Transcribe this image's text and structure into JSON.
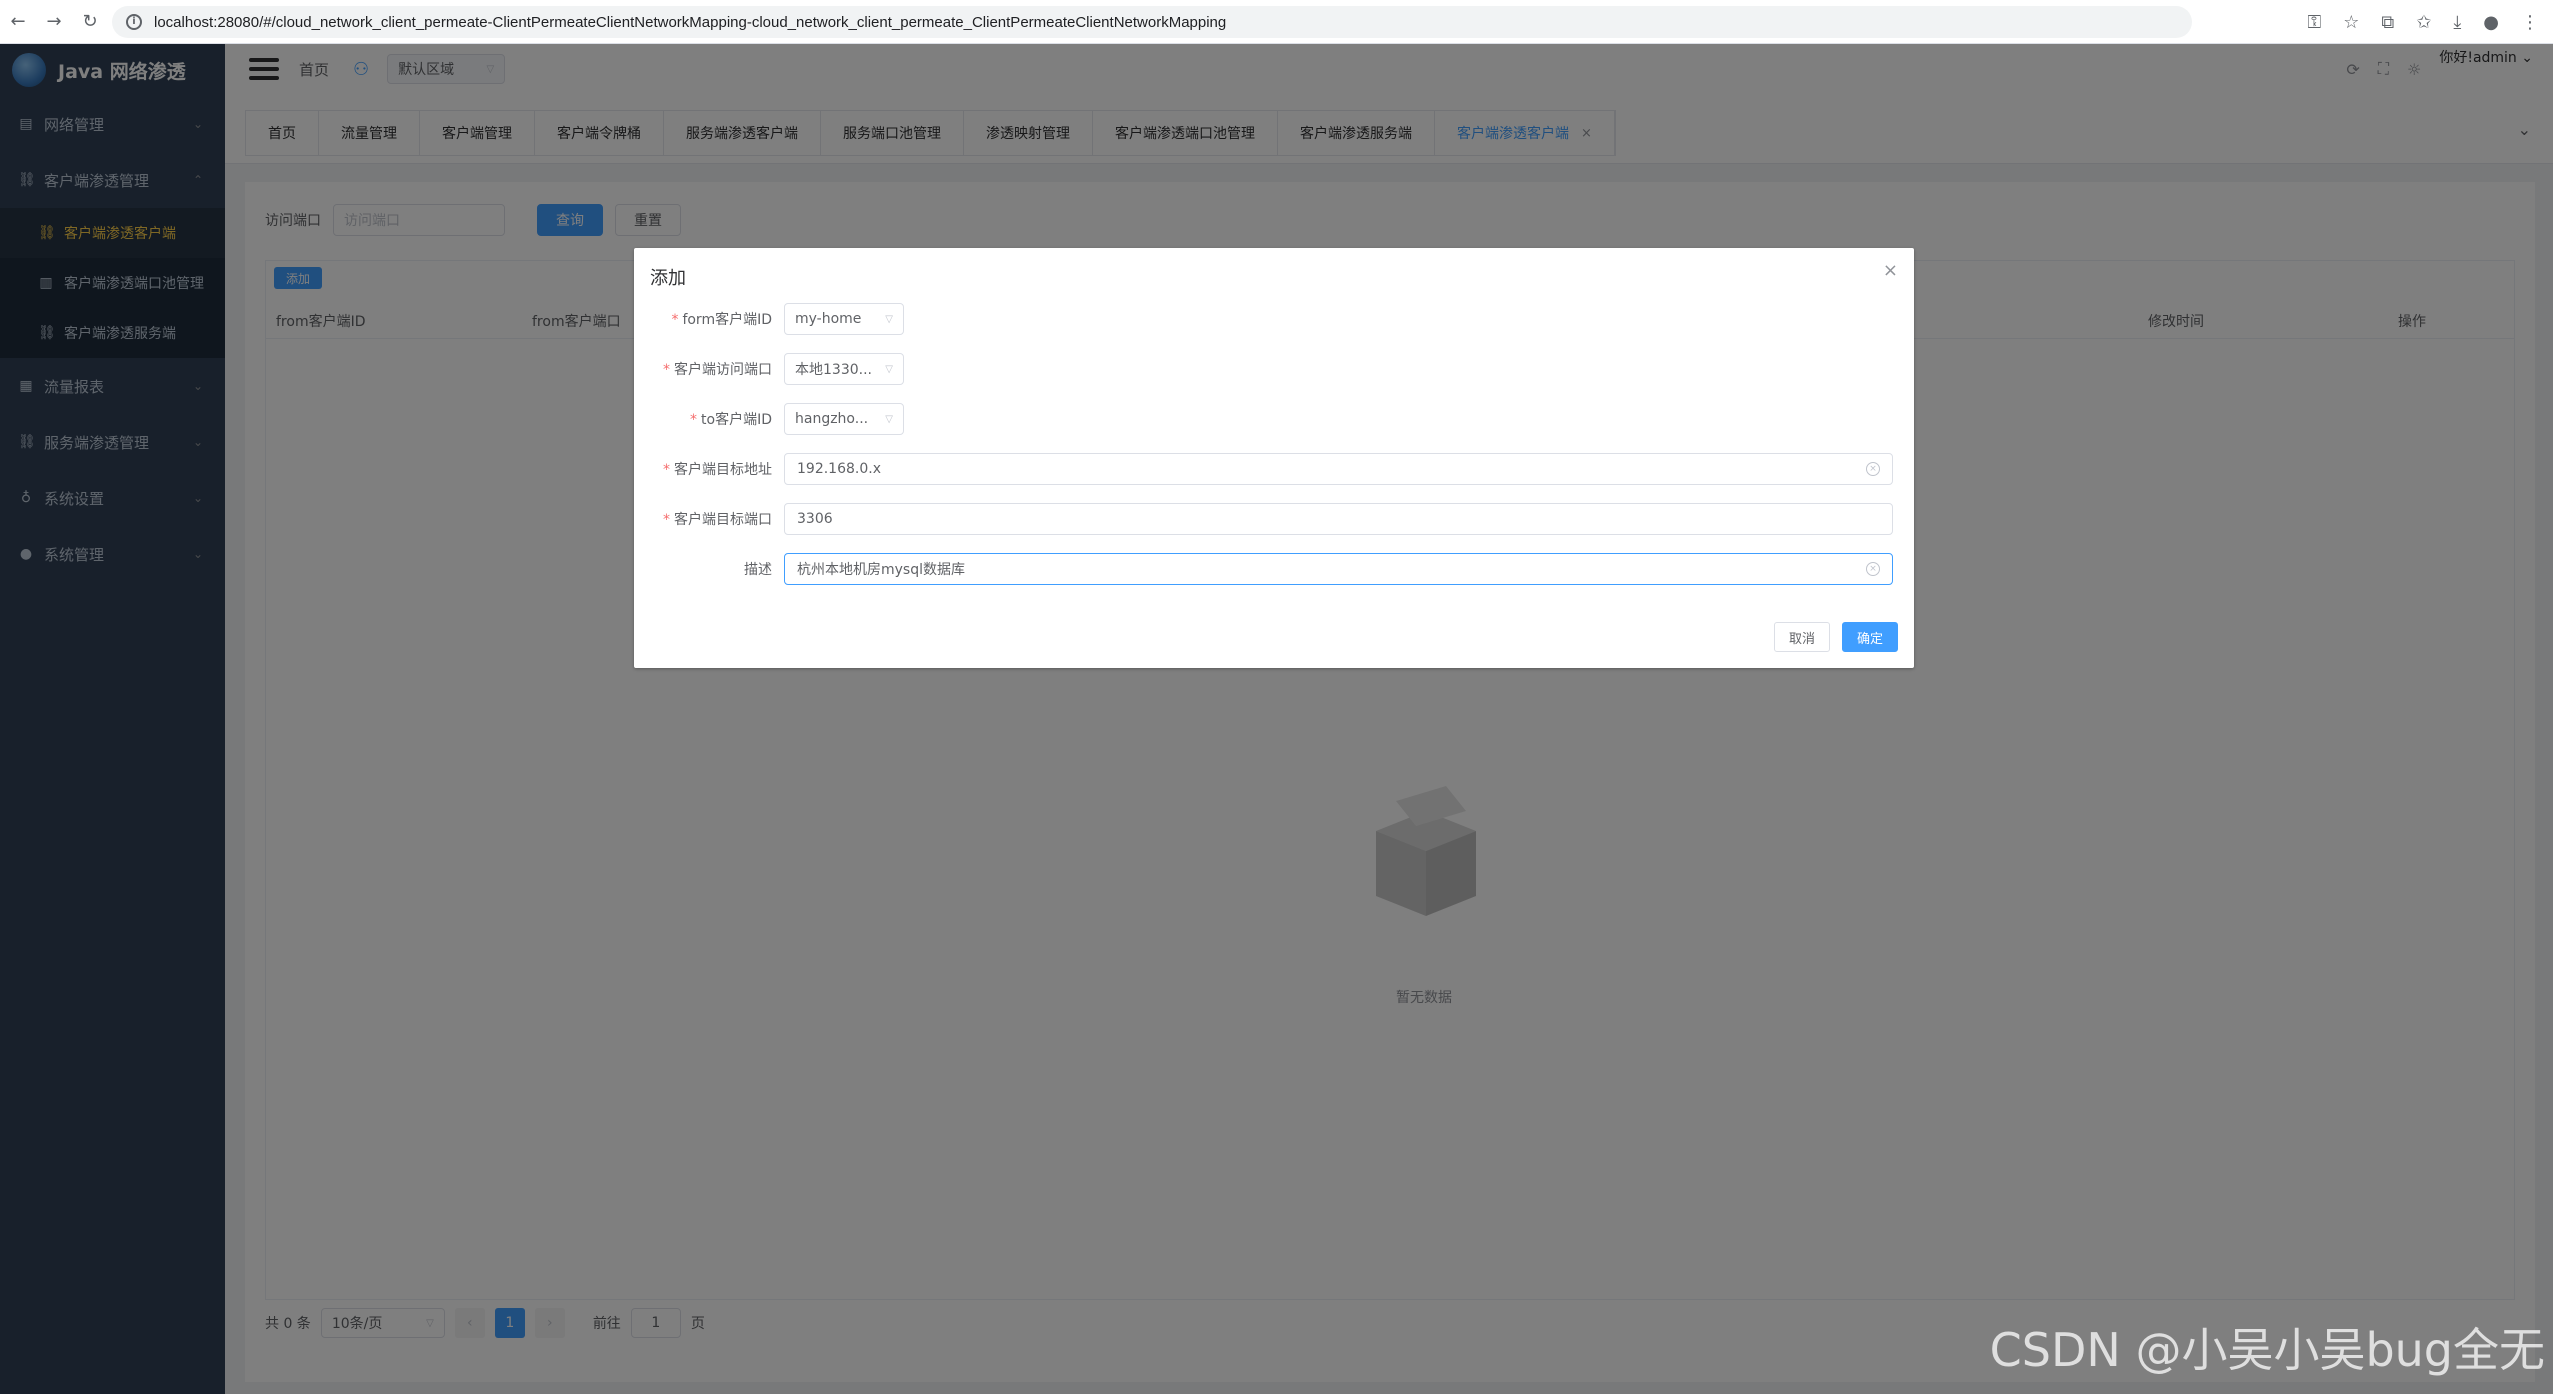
{
  "browser": {
    "url": "localhost:28080/#/cloud_network_client_permeate-ClientPermeateClientNetworkMapping-cloud_network_client_permeate_ClientPermeateClientNetworkMapping"
  },
  "app": {
    "title": "Java 网络渗透"
  },
  "sidebar": {
    "items": [
      {
        "label": "网络管理",
        "icon": "document-icon"
      },
      {
        "label": "客户端渗透管理",
        "icon": "link-icon",
        "expanded": true,
        "children": [
          {
            "label": "客户端渗透客户端",
            "active": true
          },
          {
            "label": "客户端渗透端口池管理"
          },
          {
            "label": "客户端渗透服务端"
          }
        ]
      },
      {
        "label": "流量报表",
        "icon": "report-icon"
      },
      {
        "label": "服务端渗透管理",
        "icon": "link-icon"
      },
      {
        "label": "系统设置",
        "icon": "mic-icon"
      },
      {
        "label": "系统管理",
        "icon": "user-icon"
      }
    ]
  },
  "navbar": {
    "breadcrumb": "首页",
    "region": "默认区域",
    "greeting": "你好!admin"
  },
  "tags": [
    {
      "label": "首页"
    },
    {
      "label": "流量管理"
    },
    {
      "label": "客户端管理"
    },
    {
      "label": "客户端令牌桶"
    },
    {
      "label": "服务端渗透客户端"
    },
    {
      "label": "服务端口池管理"
    },
    {
      "label": "渗透映射管理"
    },
    {
      "label": "客户端渗透端口池管理"
    },
    {
      "label": "客户端渗透服务端"
    },
    {
      "label": "客户端渗透客户端",
      "active": true
    }
  ],
  "search": {
    "label": "访问端口",
    "placeholder": "访问端口",
    "query_button": "查询",
    "reset_button": "重置"
  },
  "table": {
    "add_button": "添加",
    "columns": [
      "from客户端ID",
      "from客户端口",
      "修改时间",
      "操作"
    ],
    "empty_text": "暂无数据"
  },
  "pagination": {
    "total": "共 0 条",
    "page_size": "10条/页",
    "current_page": "1",
    "goto_label": "前往",
    "goto_value": "1",
    "page_suffix": "页"
  },
  "dialog": {
    "title": "添加",
    "fields": [
      {
        "label": "form客户端ID",
        "value": "my-home",
        "type": "select",
        "required": true
      },
      {
        "label": "客户端访问端口",
        "value": "本地1330...",
        "type": "select",
        "required": true
      },
      {
        "label": "to客户端ID",
        "value": "hangzho...",
        "type": "select",
        "required": true
      },
      {
        "label": "客户端目标地址",
        "value": "192.168.0.x",
        "type": "input",
        "required": true
      },
      {
        "label": "客户端目标端口",
        "value": "3306",
        "type": "input",
        "required": true
      },
      {
        "label": "描述",
        "value": "杭州本地机房mysql数据库",
        "type": "input",
        "required": false
      }
    ],
    "cancel_button": "取消",
    "confirm_button": "确定"
  },
  "watermark": "CSDN @小吴小吴bug全无",
  "colors": {
    "primary": "#409eff",
    "sidebar": "#304156",
    "active_menu": "#ffd04b",
    "required": "#f56c6c"
  }
}
